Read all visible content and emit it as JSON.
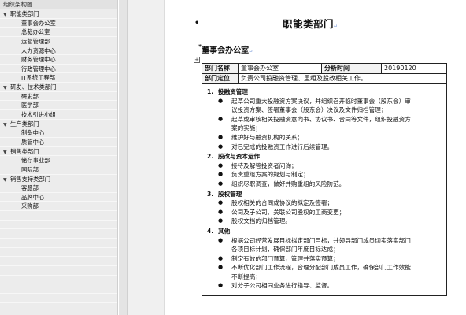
{
  "nav": {
    "title": "组织架构图",
    "items": [
      {
        "label": "职能类部门",
        "level": 0,
        "expandable": true
      },
      {
        "label": "董事会办公室",
        "level": 1
      },
      {
        "label": "总裁办公室",
        "level": 1
      },
      {
        "label": "运营管理部",
        "level": 1
      },
      {
        "label": "人力资源中心",
        "level": 1
      },
      {
        "label": "财务管理中心",
        "level": 1
      },
      {
        "label": "行政管理中心",
        "level": 1
      },
      {
        "label": "IT系统工程部",
        "level": 1
      },
      {
        "label": "研发、技术类部门",
        "level": 0,
        "expandable": true
      },
      {
        "label": "研发部",
        "level": 1
      },
      {
        "label": "医学部",
        "level": 1
      },
      {
        "label": "技术引进小组",
        "level": 1
      },
      {
        "label": "生产类部门",
        "level": 0,
        "expandable": true
      },
      {
        "label": "制备中心",
        "level": 1
      },
      {
        "label": "质管中心",
        "level": 1
      },
      {
        "label": "销售类部门",
        "level": 0,
        "expandable": true
      },
      {
        "label": "储存事业部",
        "level": 1
      },
      {
        "label": "国际部",
        "level": 1
      },
      {
        "label": "销售支持类部门",
        "level": 0,
        "expandable": true
      },
      {
        "label": "客服部",
        "level": 1
      },
      {
        "label": "品牌中心",
        "level": 1
      },
      {
        "label": "采购部",
        "level": 1
      }
    ]
  },
  "doc": {
    "title_bullet": "•",
    "title": "职能类部门",
    "section_star": "*",
    "section_heading": "董事会办公室",
    "anchor_symbol": "+",
    "table": {
      "dept_name_label": "部门名称",
      "dept_name_value": "董事会办公室",
      "analysis_time_label": "分析时间",
      "analysis_time_value": "20190120",
      "positioning_label": "部门定位",
      "positioning_value": "负责公司投融资管理、重组及股改相关工作。"
    },
    "groups": [
      {
        "num": "1.",
        "title": "投融资管理",
        "items": [
          [
            "起草公司重大投融资方案决议，并组织召开临时董事会（股东会）审",
            "议投资方案、签署董事会（股东会）决议及文件归档管理；"
          ],
          [
            "起草或审核相关投融资意向书、协议书、合同等文件，组织投融资方",
            "案的实施；"
          ],
          [
            "维护好与融资机构的关系；"
          ],
          [
            "对已完成的投融资工作进行后续管理。"
          ]
        ]
      },
      {
        "num": "2.",
        "title": "股改与资本运作",
        "items": [
          [
            "接待及解答投资者问询；"
          ],
          [
            "负责重组方案的规划与制定；"
          ],
          [
            "组织尽职调查，做好并购重组的风险防范。"
          ]
        ]
      },
      {
        "num": "3.",
        "title": "股权管理",
        "items": [
          [
            "股权相关的合同或协议的拟定及签署；"
          ],
          [
            "公司及子公司、关联公司股权的工商变更；"
          ],
          [
            "股权文档的归档管理。"
          ]
        ]
      },
      {
        "num": "4.",
        "title": "其他",
        "items": [
          [
            "根据公司经营发展目标拟定部门目标，并领导部门成员切实落实部门",
            "各项目标计划，确保部门年度目标达成；"
          ],
          [
            "制定有效的部门预算，管理并落实预算；"
          ],
          [
            "不断优化部门工作流程，合理分配部门成员工作，确保部门工作效能",
            "不断提高；"
          ],
          [
            "对分子公司相同业务进行指导、监督。"
          ]
        ]
      }
    ]
  }
}
